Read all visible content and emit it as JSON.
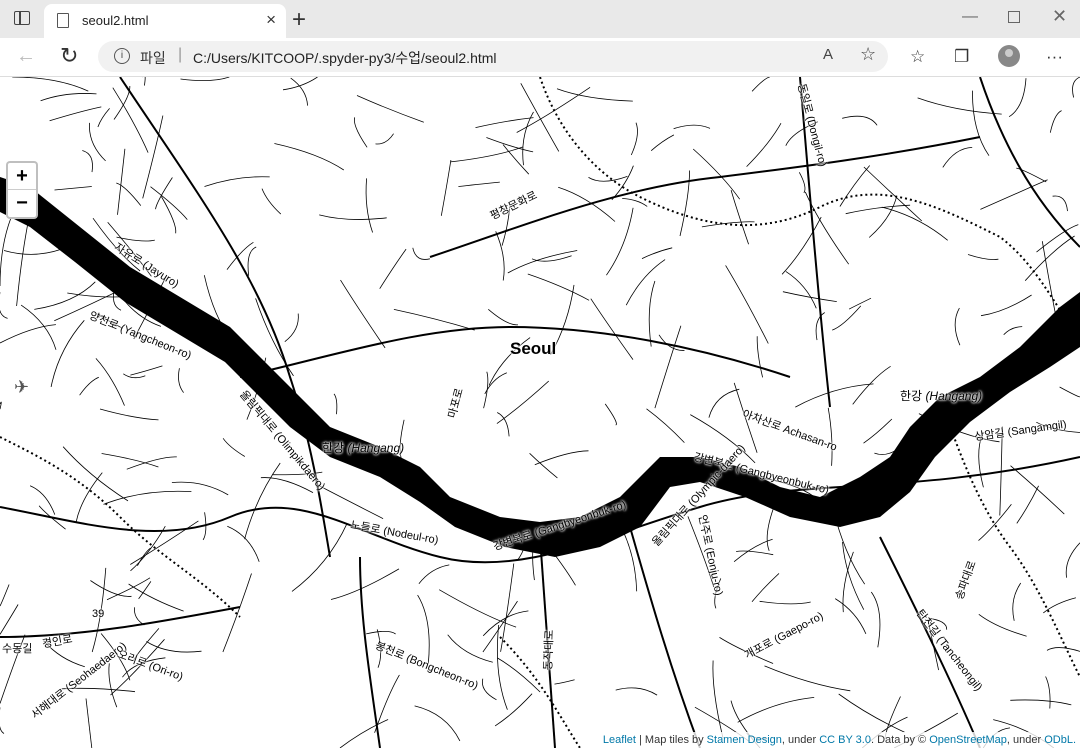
{
  "browser": {
    "tab_title": "seoul2.html",
    "tab_close": "×",
    "new_tab": "+",
    "window_minimize": "—",
    "window_close": "✕",
    "address_scheme": "파일",
    "address_url": "C:/Users/KITCOOP/.spyder-py3/수업/seoul2.html",
    "read_aloud_icon": "A",
    "favorite_icon": "☆"
  },
  "map": {
    "zoom_in_label": "+",
    "zoom_out_label": "−",
    "city_label": "Seoul",
    "river_labels": [
      {
        "native": "한강",
        "roman": "(Hangang)"
      },
      {
        "native": "한강",
        "roman": "(Hangang)"
      }
    ],
    "road_labels": [
      "자유로 (Jayuro)",
      "양천로 (Yangcheon-ro)",
      "올림픽대로 (Olimpikdaero)",
      "강변북로 (Gangbyeonbuk-ro)",
      "노들로 (Nodeul-ro)",
      "강변북로 (Gangbyeonbuk-ro)",
      "올림픽대로 (Olympic-daero)",
      "아차산로 Achasan-ro",
      "상암길 (Sangamgil)",
      "평창문화로",
      "동일로 (Dongil-ro)",
      "언주로 (Eonju-ro)",
      "개포로 (Gaepo-ro)",
      "탄천길 (Tancheongil)",
      "봉천로 (Bongcheon-ro)",
      "오리로 (Ori-ro)",
      "서해대로 (Seohaedaero)",
      "수동길",
      "경인로",
      "마포로",
      "동작대로",
      "송파대로",
      "39"
    ],
    "attribution": {
      "leaflet": "Leaflet",
      "tiles_by": " | Map tiles by ",
      "stamen": "Stamen Design",
      "under1": ", under ",
      "ccby": "CC BY 3.0",
      "data_by": ". Data by © ",
      "osm": "OpenStreetMap",
      "under2": ", under ",
      "odbl": "ODbL."
    }
  },
  "colors": {
    "river": "#000000",
    "road": "#000000",
    "background": "#ffffff",
    "link": "#0078a8"
  }
}
